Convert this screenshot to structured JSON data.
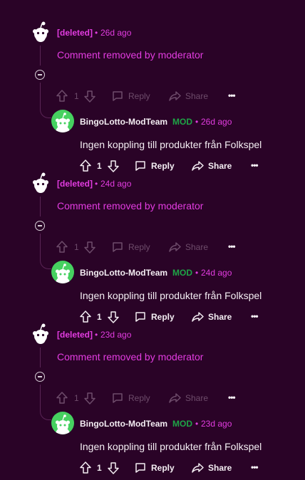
{
  "colors": {
    "background": "#2a0327",
    "accent": "#e23ce0",
    "mod_badge": "#1ea446",
    "avatar": "#46d160",
    "text": "#f4eef3",
    "dim": "#6e4c6b"
  },
  "threads": [
    {
      "deleted_author": "[deleted]",
      "deleted_age": "26d ago",
      "removed_text": "Comment removed by moderator",
      "deleted_actions": {
        "score": "1",
        "reply_label": "Reply",
        "share_label": "Share",
        "more_label": "•••"
      },
      "reply": {
        "author": "BingoLotto-ModTeam",
        "badge": "MOD",
        "age": "26d ago",
        "body": "Ingen koppling till produkter från Folkspel",
        "actions": {
          "score": "1",
          "reply_label": "Reply",
          "share_label": "Share",
          "more_label": "•••"
        }
      }
    },
    {
      "deleted_author": "[deleted]",
      "deleted_age": "24d ago",
      "removed_text": "Comment removed by moderator",
      "deleted_actions": {
        "score": "1",
        "reply_label": "Reply",
        "share_label": "Share",
        "more_label": "•••"
      },
      "reply": {
        "author": "BingoLotto-ModTeam",
        "badge": "MOD",
        "age": "24d ago",
        "body": "Ingen koppling till produkter från Folkspel",
        "actions": {
          "score": "1",
          "reply_label": "Reply",
          "share_label": "Share",
          "more_label": "•••"
        }
      }
    },
    {
      "deleted_author": "[deleted]",
      "deleted_age": "23d ago",
      "removed_text": "Comment removed by moderator",
      "deleted_actions": {
        "score": "1",
        "reply_label": "Reply",
        "share_label": "Share",
        "more_label": "•••"
      },
      "reply": {
        "author": "BingoLotto-ModTeam",
        "badge": "MOD",
        "age": "23d ago",
        "body": "Ingen koppling till produkter från Folkspel",
        "actions": {
          "score": "1",
          "reply_label": "Reply",
          "share_label": "Share",
          "more_label": "•••"
        }
      }
    }
  ],
  "icons": {
    "deleted_avatar": "snoo-icon",
    "mod_avatar": "snoo-avatar",
    "upvote": "upvote-icon",
    "downvote": "downvote-icon",
    "reply": "comment-bubble-icon",
    "share": "share-arrow-icon",
    "more": "more-horizontal-icon",
    "collapse": "collapse-minus-icon"
  }
}
